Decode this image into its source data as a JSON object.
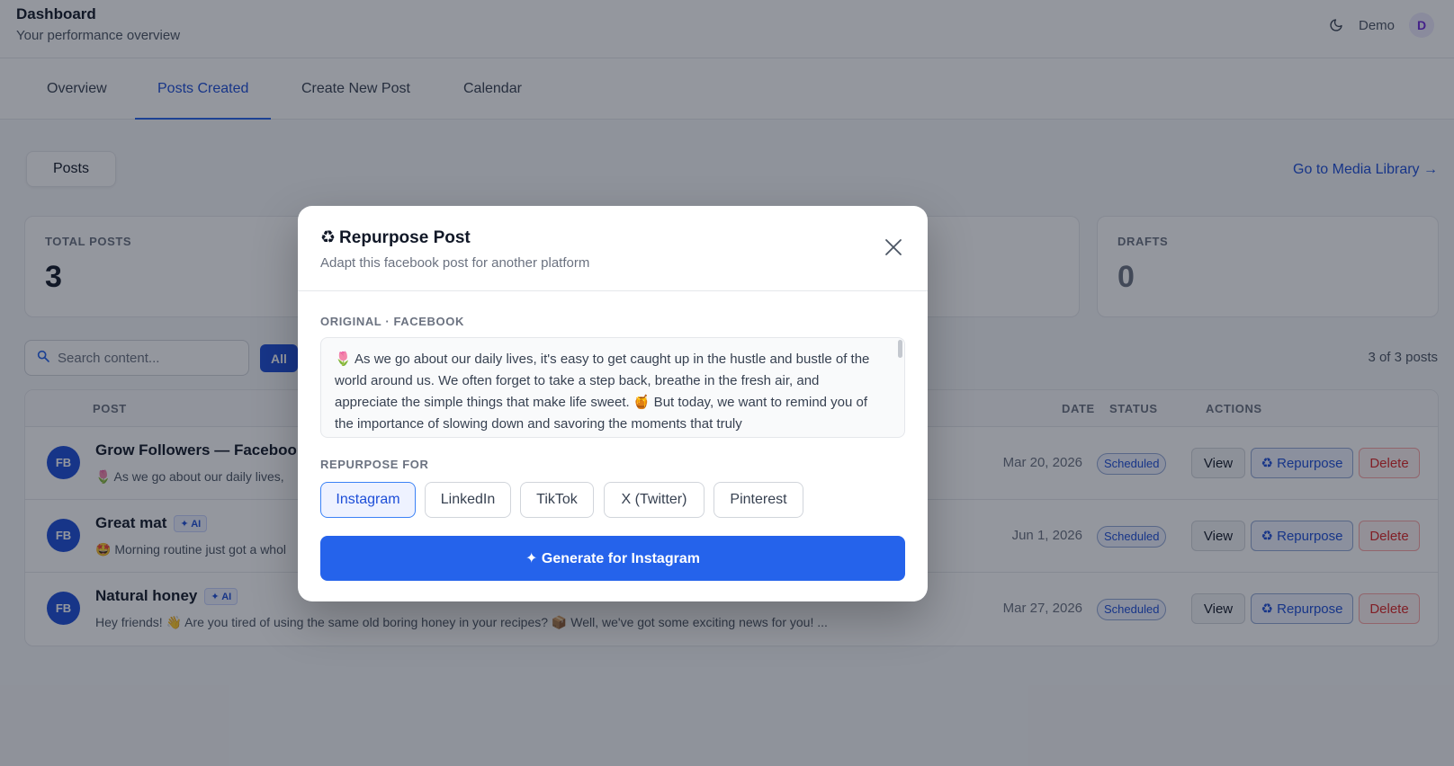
{
  "header": {
    "title": "Dashboard",
    "subtitle": "Your performance overview",
    "user_name": "Demo",
    "avatar_initial": "D",
    "theme_icon": "moon-icon"
  },
  "tabs": [
    {
      "label": "Overview",
      "active": false
    },
    {
      "label": "Posts Created",
      "active": true
    },
    {
      "label": "Create New Post",
      "active": false
    },
    {
      "label": "Calendar",
      "active": false
    }
  ],
  "posts_section": {
    "pill_label": "Posts",
    "media_link": "Go to Media Library →"
  },
  "stats": [
    {
      "label": "TOTAL POSTS",
      "value": "3"
    },
    {
      "label": "DRAFTS",
      "value": "0"
    }
  ],
  "search": {
    "placeholder": "Search content...",
    "value": ""
  },
  "filter": {
    "all_label": "All"
  },
  "count_text": "3 of 3 posts",
  "table": {
    "headers": {
      "post": "POST",
      "date": "DATE",
      "status": "STATUS",
      "actions": "ACTIONS"
    },
    "rows": [
      {
        "avatar": "FB",
        "title": "Grow Followers — Facebook",
        "ai": "",
        "excerpt": "🌷 As we go about our daily lives,",
        "date": "Mar 20, 2026",
        "status": "Scheduled"
      },
      {
        "avatar": "FB",
        "title": "Great mat",
        "ai": "✦ AI",
        "excerpt": "🤩 Morning routine just got a whol",
        "date": "Jun 1, 2026",
        "status": "Scheduled"
      },
      {
        "avatar": "FB",
        "title": "Natural honey",
        "ai": "✦ AI",
        "excerpt": "Hey friends! 👋 Are you tired of using the same old boring honey in your recipes? 📦 Well, we've got some exciting news for you! ...",
        "date": "Mar 27, 2026",
        "status": "Scheduled"
      }
    ],
    "actions": {
      "view": "View",
      "repurpose": "♻ Repurpose",
      "delete": "Delete"
    }
  },
  "modal": {
    "icon": "♻",
    "title": "Repurpose Post",
    "subtitle": "Adapt this facebook post for another platform",
    "original_label": "ORIGINAL · FACEBOOK",
    "original_text": "🌷 As we go about our daily lives, it's easy to get caught up in the hustle and bustle of the world around us. We often forget to take a step back, breathe in the fresh air, and appreciate the simple things that make life sweet. 🍯 But today, we want to remind you of the importance of slowing down and savoring the moments that truly",
    "repurpose_label": "REPURPOSE FOR",
    "platforms": [
      {
        "label": "Instagram",
        "active": true
      },
      {
        "label": "LinkedIn",
        "active": false
      },
      {
        "label": "TikTok",
        "active": false
      },
      {
        "label": "X (Twitter)",
        "active": false
      },
      {
        "label": "Pinterest",
        "active": false
      }
    ],
    "generate_label": "✦ Generate for Instagram"
  }
}
